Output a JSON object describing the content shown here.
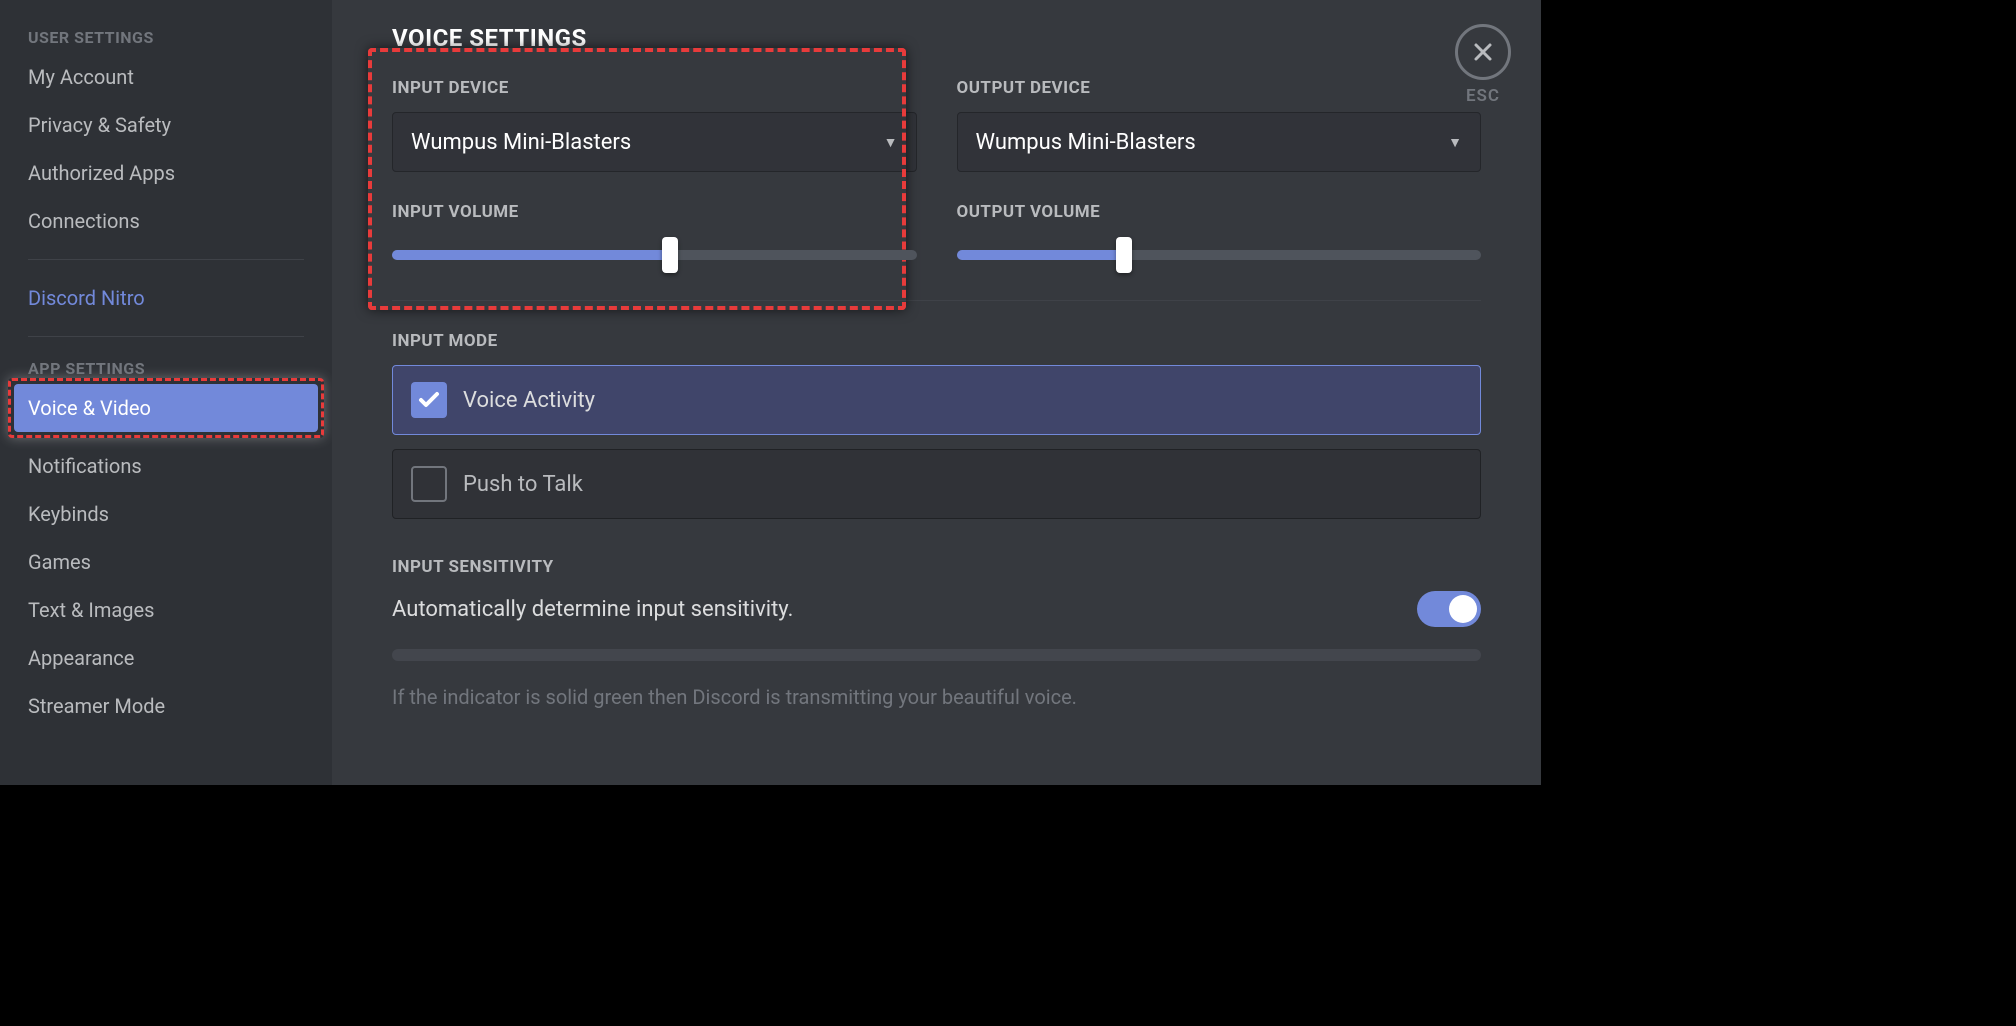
{
  "sidebar": {
    "header1": "USER SETTINGS",
    "user_items": [
      "My Account",
      "Privacy & Safety",
      "Authorized Apps",
      "Connections"
    ],
    "nitro": "Discord Nitro",
    "header2": "APP SETTINGS",
    "app_items": [
      "Voice & Video",
      "Notifications",
      "Keybinds",
      "Games",
      "Text & Images",
      "Appearance",
      "Streamer Mode"
    ]
  },
  "main": {
    "title": "VOICE SETTINGS",
    "input_device_label": "INPUT DEVICE",
    "input_device_value": "Wumpus Mini-Blasters",
    "output_device_label": "OUTPUT DEVICE",
    "output_device_value": "Wumpus Mini-Blasters",
    "input_volume_label": "INPUT VOLUME",
    "output_volume_label": "OUTPUT VOLUME",
    "input_volume_pct": 53,
    "output_volume_pct": 32,
    "input_mode_label": "INPUT MODE",
    "mode_voice_activity": "Voice Activity",
    "mode_push_to_talk": "Push to Talk",
    "sensitivity_label": "INPUT SENSITIVITY",
    "sensitivity_text": "Automatically determine input sensitivity.",
    "sensitivity_toggle": true,
    "hint": "If the indicator is solid green then Discord is transmitting your beautiful voice.",
    "esc_label": "ESC"
  }
}
